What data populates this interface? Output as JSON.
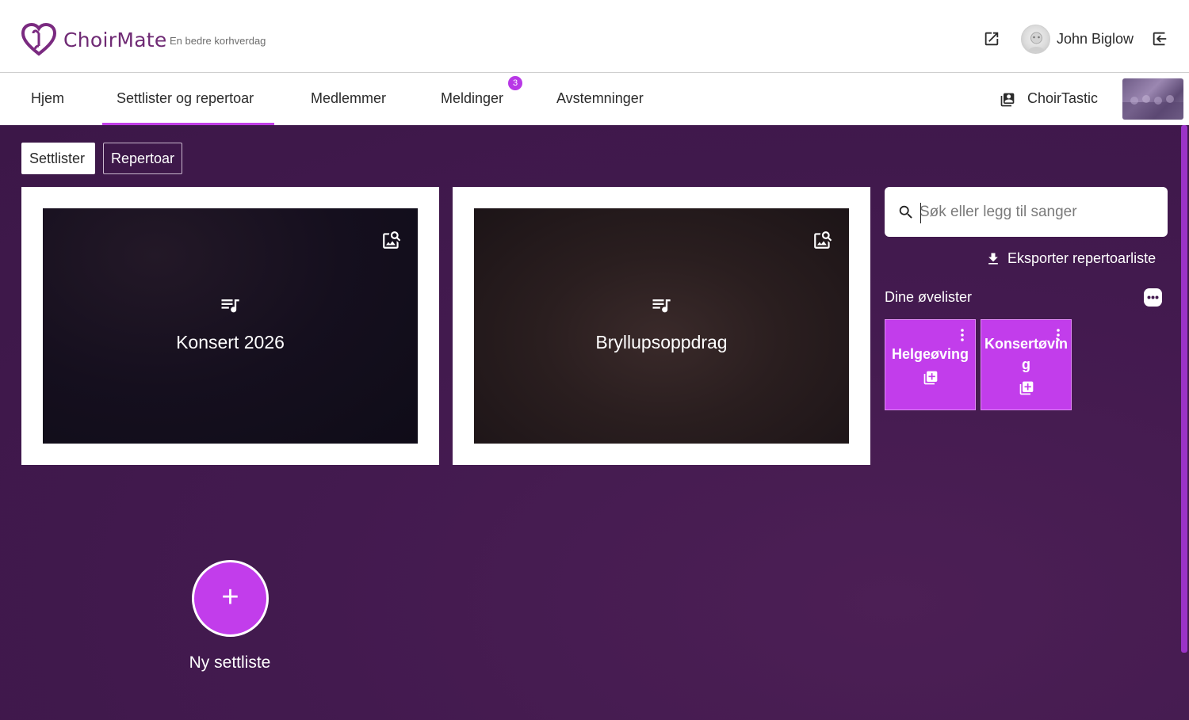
{
  "header": {
    "brand": "ChoirMate",
    "tagline": "En bedre korhverdag",
    "user_name": "John Biglow"
  },
  "nav": {
    "items": [
      "Hjem",
      "Settlister og repertoar",
      "Medlemmer",
      "Meldinger",
      "Avstemninger"
    ],
    "active": "Settlister og repertoar",
    "messages_badge": "3",
    "choir_name": "ChoirTastic"
  },
  "tabs": {
    "settlister": "Settlister",
    "repertoar": "Repertoar"
  },
  "setlists": [
    {
      "title": "Konsert 2026"
    },
    {
      "title": "Bryllupsoppdrag"
    }
  ],
  "search": {
    "placeholder": "Søk eller legg til sanger"
  },
  "export": {
    "label": "Eksporter repertoarliste"
  },
  "practice": {
    "title": "Dine øvelister",
    "lists": [
      {
        "label": "Helgeøving"
      },
      {
        "label": "Konsertøving"
      }
    ]
  },
  "new_setlist": {
    "symbol": "+",
    "label": "Ny settliste"
  },
  "colors": {
    "accent": "#c23deb",
    "brand": "#6f2a74",
    "background": "#431a4f"
  }
}
